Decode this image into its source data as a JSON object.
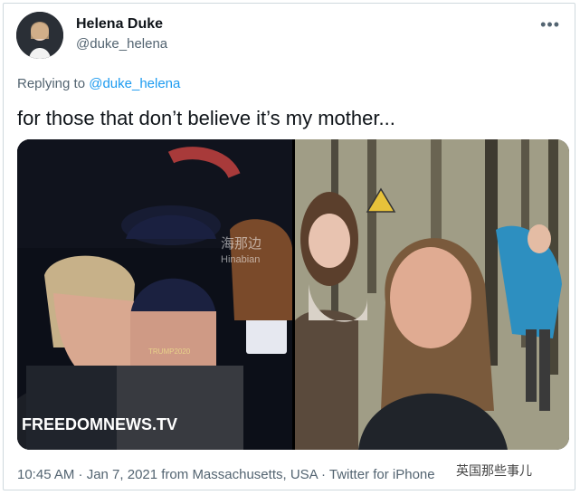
{
  "tweet": {
    "display_name": "Helena Duke",
    "handle": "@duke_helena",
    "more_icon": "ellipsis-icon",
    "replying_prefix": "Replying to",
    "replying_handle": "@duke_helena",
    "text": "for those that don’t believe it’s my mother...",
    "timestamp": "10:45 AM · Jan 7, 2021 from Massachusetts, USA · Twitter for iPhone"
  },
  "media": {
    "left_caption": "FREEDOMNEWS.TV",
    "hat_text": "TRUMP2020",
    "watermark_top": "海那边",
    "watermark_bottom": "Hinabian"
  },
  "watermark": "英国那些事儿"
}
